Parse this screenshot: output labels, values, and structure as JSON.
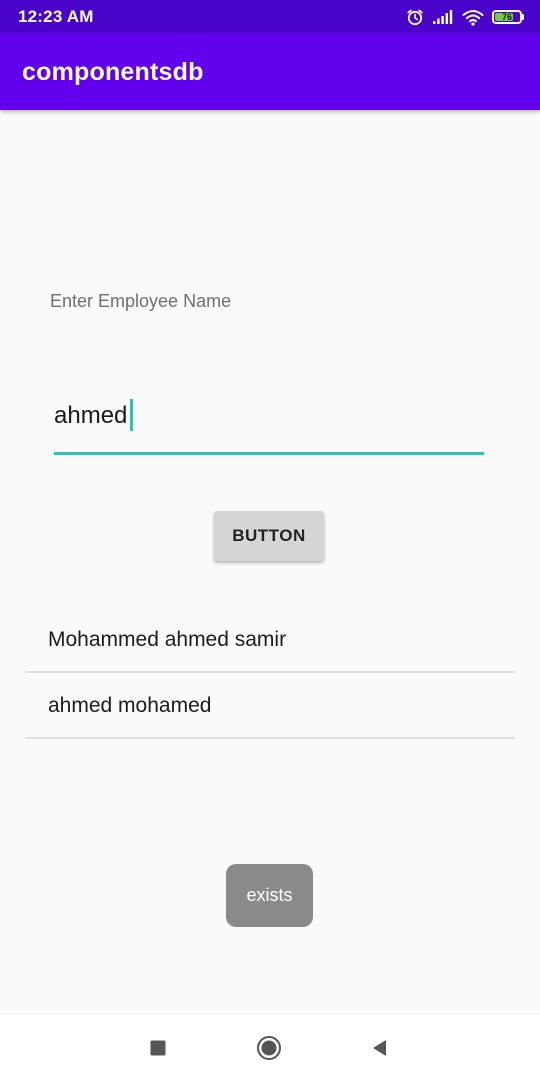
{
  "status_bar": {
    "time": "12:23 AM",
    "battery_level": "76",
    "battery_fraction": 0.76,
    "icons": [
      "alarm-icon",
      "signal-icon",
      "wifi-icon",
      "battery-icon"
    ]
  },
  "app_bar": {
    "title": "componentsdb"
  },
  "form": {
    "label": "Enter Employee Name",
    "input_value": "ahmed",
    "button_label": "BUTTON"
  },
  "list": {
    "items": [
      {
        "text": "Mohammed ahmed samir"
      },
      {
        "text": "ahmed mohamed"
      }
    ]
  },
  "toast": {
    "text": "exists"
  },
  "nav_bar": {
    "icons": [
      "recents-icon",
      "home-icon",
      "back-icon"
    ]
  },
  "colors": {
    "status_bar": "#4a03c8",
    "app_bar": "#6200ee",
    "accent": "#26c6b9",
    "button": "#d6d6d6",
    "toast": "#8a8a8a",
    "background": "#fafafa"
  }
}
